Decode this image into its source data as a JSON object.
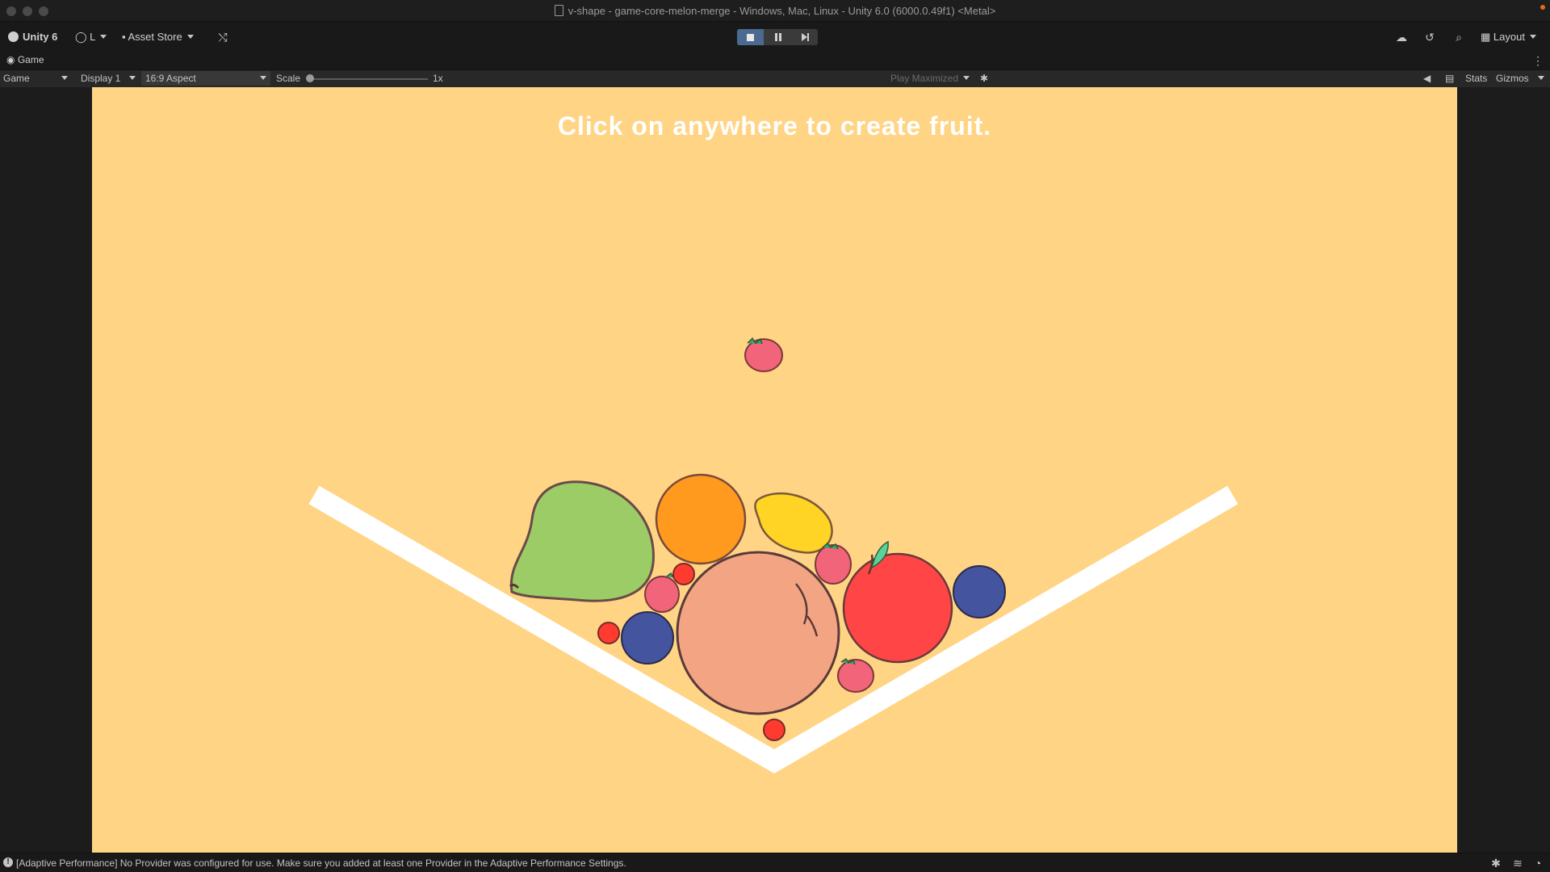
{
  "window": {
    "title": "v-shape - game-core-melon-merge - Windows, Mac, Linux - Unity 6.0 (6000.0.49f1) <Metal>"
  },
  "toolbar": {
    "unity_label": "Unity 6",
    "account_label": "L",
    "asset_store_label": "Asset Store",
    "layout_label": "Layout"
  },
  "tab": {
    "label": "Game"
  },
  "gamebar": {
    "view_select": "Game",
    "display_select": "Display 1",
    "aspect_select": "16:9 Aspect",
    "scale_label": "Scale",
    "scale_value": "1x",
    "play_mode_select": "Play Maximized",
    "stats_label": "Stats",
    "gizmos_label": "Gizmos"
  },
  "game": {
    "instruction": "Click on anywhere to create fruit.",
    "fruits": [
      "strawberry",
      "pear",
      "orange",
      "lemon",
      "strawberry",
      "apple",
      "blueberry",
      "strawberry",
      "cherry",
      "cherry",
      "blueberry",
      "peach",
      "strawberry",
      "cherry"
    ]
  },
  "status": {
    "message": "[Adaptive Performance] No Provider was configured for use. Make sure you added at least one Provider in the Adaptive Performance Settings."
  },
  "colors": {
    "game_background": "#ffd484",
    "play_active": "#4a6a90"
  }
}
